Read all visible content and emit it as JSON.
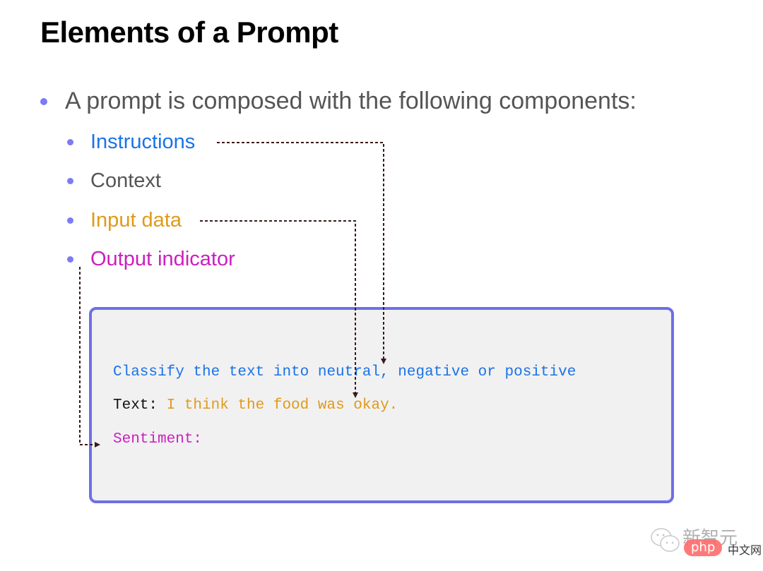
{
  "slide": {
    "title": "Elements of a Prompt",
    "intro": "A prompt is composed with the following components:",
    "components": [
      {
        "label": "Instructions",
        "color": "#1a73e8"
      },
      {
        "label": "Context",
        "color": "#555555"
      },
      {
        "label": "Input data",
        "color": "#e09a1a"
      },
      {
        "label": "Output indicator",
        "color": "#cc1fbf"
      }
    ],
    "example": {
      "instruction_line": "Classify the text into neutral, negative or positive",
      "input_prefix": "Text: ",
      "input_value": "I think the food was okay.",
      "output_line": "Sentiment:"
    },
    "colors": {
      "bullet": "#7b7bf5",
      "box_border": "#6f6fe8",
      "box_fill": "#f1f1f1",
      "arrow": "#3a1a1a"
    }
  },
  "watermark": {
    "brand": "新智元",
    "site_badge": "php",
    "site_suffix": "中文网"
  }
}
